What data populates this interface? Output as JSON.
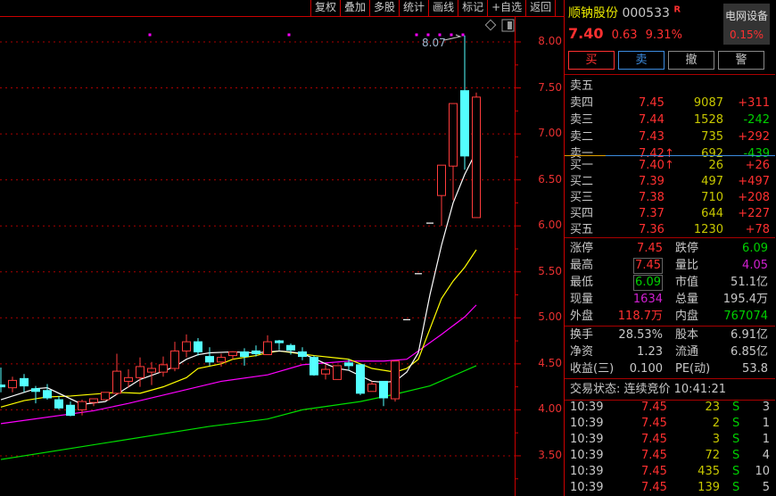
{
  "toolbar": [
    "复权",
    "叠加",
    "多股",
    "统计",
    "画线",
    "标记",
    "+自选",
    "返回"
  ],
  "stock": {
    "name": "顺钠股份",
    "code": "000533",
    "flag": "R",
    "price": "7.40",
    "change": "0.63",
    "change_pct": "9.31%",
    "sector": "电网设备",
    "sector_pct": "0.15%"
  },
  "actions": [
    "买",
    "卖",
    "撤",
    "警"
  ],
  "order_book": {
    "asks": [
      {
        "label": "卖五",
        "price": "",
        "vol": "",
        "chg": ""
      },
      {
        "label": "卖四",
        "price": "7.45",
        "vol": "9087",
        "chg": "+311"
      },
      {
        "label": "卖三",
        "price": "7.44",
        "vol": "1528",
        "chg": "-242"
      },
      {
        "label": "卖二",
        "price": "7.43",
        "vol": "735",
        "chg": "+292"
      },
      {
        "label": "卖一",
        "price": "7.42↑",
        "vol": "692",
        "chg": "-439"
      }
    ],
    "bids": [
      {
        "label": "买一",
        "price": "7.40↑",
        "vol": "26",
        "chg": "+26"
      },
      {
        "label": "买二",
        "price": "7.39",
        "vol": "497",
        "chg": "+497"
      },
      {
        "label": "买三",
        "price": "7.38",
        "vol": "710",
        "chg": "+208"
      },
      {
        "label": "买四",
        "price": "7.37",
        "vol": "644",
        "chg": "+227"
      },
      {
        "label": "买五",
        "price": "7.36",
        "vol": "1230",
        "chg": "+78"
      }
    ]
  },
  "stats": [
    {
      "l1": "涨停",
      "v1": "7.45",
      "c1": "r",
      "l2": "跌停",
      "v2": "6.09",
      "c2": "g"
    },
    {
      "l1": "最高",
      "v1": "7.45",
      "c1": "r",
      "l2": "量比",
      "v2": "4.05",
      "c2": "m"
    },
    {
      "l1": "最低",
      "v1": "6.09",
      "c1": "g",
      "l2": "市值",
      "v2": "51.1亿",
      "c2": "w"
    },
    {
      "l1": "现量",
      "v1": "1634",
      "c1": "m",
      "l2": "总量",
      "v2": "195.4万",
      "c2": "w"
    },
    {
      "l1": "外盘",
      "v1": "118.7万",
      "c1": "r",
      "l2": "内盘",
      "v2": "767074",
      "c2": "g"
    }
  ],
  "fundamentals": [
    {
      "l1": "换手",
      "v1": "28.53%",
      "l2": "股本",
      "v2": "6.91亿"
    },
    {
      "l1": "净资",
      "v1": "1.23",
      "l2": "流通",
      "v2": "6.85亿"
    },
    {
      "l1": "收益(三)",
      "v1": "0.100",
      "l2": "PE(动)",
      "v2": "53.8"
    }
  ],
  "trade_status": "交易状态: 连续竞价 10:41:21",
  "ticks": [
    {
      "time": "10:39",
      "price": "7.45",
      "vol": "23",
      "side": "S",
      "n": "3"
    },
    {
      "time": "10:39",
      "price": "7.45",
      "vol": "2",
      "side": "S",
      "n": "1"
    },
    {
      "time": "10:39",
      "price": "7.45",
      "vol": "3",
      "side": "S",
      "n": "1"
    },
    {
      "time": "10:39",
      "price": "7.45",
      "vol": "72",
      "side": "S",
      "n": "4"
    },
    {
      "time": "10:39",
      "price": "7.45",
      "vol": "435",
      "side": "S",
      "n": "10"
    },
    {
      "time": "10:39",
      "price": "7.45",
      "vol": "139",
      "side": "S",
      "n": "5"
    }
  ],
  "chart_data": {
    "type": "candlestick",
    "y_ticks": [
      "8.00",
      "7.50",
      "7.00",
      "6.50",
      "6.00",
      "5.50",
      "5.00",
      "4.50",
      "4.00",
      "3.50"
    ],
    "ylim": [
      3.4,
      8.1
    ],
    "high_label": "8.07",
    "colors": {
      "up": "#ff3c3c",
      "down": "#54ffff",
      "ma5": "#ffffff",
      "ma10": "#ffff00",
      "ma20": "#ff00ff",
      "ma60": "#00e000"
    },
    "candles": [
      [
        4.27,
        4.25,
        4.46,
        4.19
      ],
      [
        4.24,
        4.32,
        4.36,
        4.19
      ],
      [
        4.34,
        4.26,
        4.39,
        4.19
      ],
      [
        4.23,
        4.2,
        4.26,
        4.07
      ],
      [
        4.21,
        4.13,
        4.28,
        4.11
      ],
      [
        4.11,
        4.02,
        4.15,
        4.0
      ],
      [
        4.05,
        3.94,
        4.09,
        3.93
      ],
      [
        4.0,
        4.09,
        4.11,
        3.94
      ],
      [
        4.08,
        4.12,
        4.12,
        4.04
      ],
      [
        4.11,
        4.19,
        4.19,
        4.11
      ],
      [
        4.18,
        4.42,
        4.61,
        4.16
      ],
      [
        4.31,
        4.35,
        4.44,
        4.24
      ],
      [
        4.35,
        4.47,
        4.57,
        4.25
      ],
      [
        4.41,
        4.45,
        4.52,
        4.27
      ],
      [
        4.41,
        4.49,
        4.58,
        4.36
      ],
      [
        4.45,
        4.64,
        4.74,
        4.42
      ],
      [
        4.64,
        4.74,
        4.82,
        4.57
      ],
      [
        4.74,
        4.63,
        4.78,
        4.59
      ],
      [
        4.58,
        4.52,
        4.68,
        4.48
      ],
      [
        4.52,
        4.57,
        4.61,
        4.47
      ],
      [
        4.59,
        4.63,
        4.63,
        4.55
      ],
      [
        4.63,
        4.58,
        4.67,
        4.48
      ],
      [
        4.64,
        4.61,
        4.7,
        4.58
      ],
      [
        4.6,
        4.74,
        4.81,
        4.6
      ],
      [
        4.75,
        4.73,
        4.76,
        4.65
      ],
      [
        4.7,
        4.65,
        4.72,
        4.6
      ],
      [
        4.63,
        4.58,
        4.68,
        4.54
      ],
      [
        4.57,
        4.38,
        4.59,
        4.37
      ],
      [
        4.39,
        4.44,
        4.49,
        4.33
      ],
      [
        4.33,
        4.48,
        4.48,
        4.33
      ],
      [
        4.51,
        4.48,
        4.55,
        4.43
      ],
      [
        4.49,
        4.18,
        4.49,
        4.16
      ],
      [
        4.2,
        4.28,
        4.31,
        4.2
      ],
      [
        4.31,
        4.13,
        4.31,
        4.04
      ],
      [
        4.12,
        4.53,
        4.53,
        4.09
      ],
      [
        4.98,
        4.98,
        4.98,
        4.98
      ],
      [
        5.48,
        5.48,
        5.48,
        5.48
      ],
      [
        6.03,
        6.03,
        6.03,
        6.03
      ],
      [
        6.33,
        6.66,
        6.66,
        6.0
      ],
      [
        6.65,
        7.33,
        7.33,
        6.28
      ],
      [
        7.47,
        6.76,
        8.07,
        6.61
      ],
      [
        6.09,
        7.4,
        7.45,
        6.09
      ]
    ],
    "ma5": [
      [
        0,
        4.11
      ],
      [
        3,
        4.23
      ],
      [
        4,
        4.24
      ],
      [
        7,
        4.06
      ],
      [
        9,
        4.09
      ],
      [
        10,
        4.17
      ],
      [
        12,
        4.33
      ],
      [
        14,
        4.42
      ],
      [
        15,
        4.47
      ],
      [
        16,
        4.55
      ],
      [
        17,
        4.6
      ],
      [
        18,
        4.62
      ],
      [
        20,
        4.63
      ],
      [
        22,
        4.62
      ],
      [
        24,
        4.64
      ],
      [
        25,
        4.63
      ],
      [
        26,
        4.61
      ],
      [
        27,
        4.56
      ],
      [
        28,
        4.5
      ],
      [
        29,
        4.45
      ],
      [
        30,
        4.43
      ],
      [
        31,
        4.37
      ],
      [
        32,
        4.31
      ],
      [
        33,
        4.3
      ],
      [
        34,
        4.31
      ],
      [
        35,
        4.41
      ],
      [
        36,
        4.62
      ],
      [
        37,
        5.25
      ],
      [
        38,
        5.79
      ],
      [
        39,
        6.25
      ],
      [
        40,
        6.56
      ],
      [
        41,
        6.81
      ]
    ],
    "ma10": [
      [
        0,
        4.03
      ],
      [
        2,
        4.1
      ],
      [
        4,
        4.14
      ],
      [
        6,
        4.15
      ],
      [
        10,
        4.19
      ],
      [
        12,
        4.18
      ],
      [
        14,
        4.25
      ],
      [
        16,
        4.35
      ],
      [
        17,
        4.45
      ],
      [
        19,
        4.5
      ],
      [
        20,
        4.55
      ],
      [
        22,
        4.59
      ],
      [
        23,
        4.62
      ],
      [
        24,
        4.64
      ],
      [
        27,
        4.59
      ],
      [
        30,
        4.55
      ],
      [
        32,
        4.45
      ],
      [
        34,
        4.41
      ],
      [
        35,
        4.45
      ],
      [
        36,
        4.55
      ],
      [
        38,
        5.21
      ],
      [
        39,
        5.4
      ],
      [
        40,
        5.55
      ],
      [
        41,
        5.74
      ]
    ],
    "ma20": [
      [
        0,
        3.85
      ],
      [
        8,
        3.99
      ],
      [
        11,
        4.07
      ],
      [
        15,
        4.19
      ],
      [
        19,
        4.31
      ],
      [
        23,
        4.38
      ],
      [
        26,
        4.49
      ],
      [
        30,
        4.53
      ],
      [
        33,
        4.53
      ],
      [
        35,
        4.55
      ],
      [
        38,
        4.82
      ],
      [
        40,
        5.01
      ],
      [
        41,
        5.14
      ]
    ],
    "ma60": [
      [
        0,
        3.46
      ],
      [
        18,
        3.82
      ],
      [
        23,
        3.9
      ],
      [
        26,
        4.0
      ],
      [
        31,
        4.09
      ],
      [
        34,
        4.17
      ],
      [
        37,
        4.26
      ],
      [
        41,
        4.48
      ]
    ]
  }
}
